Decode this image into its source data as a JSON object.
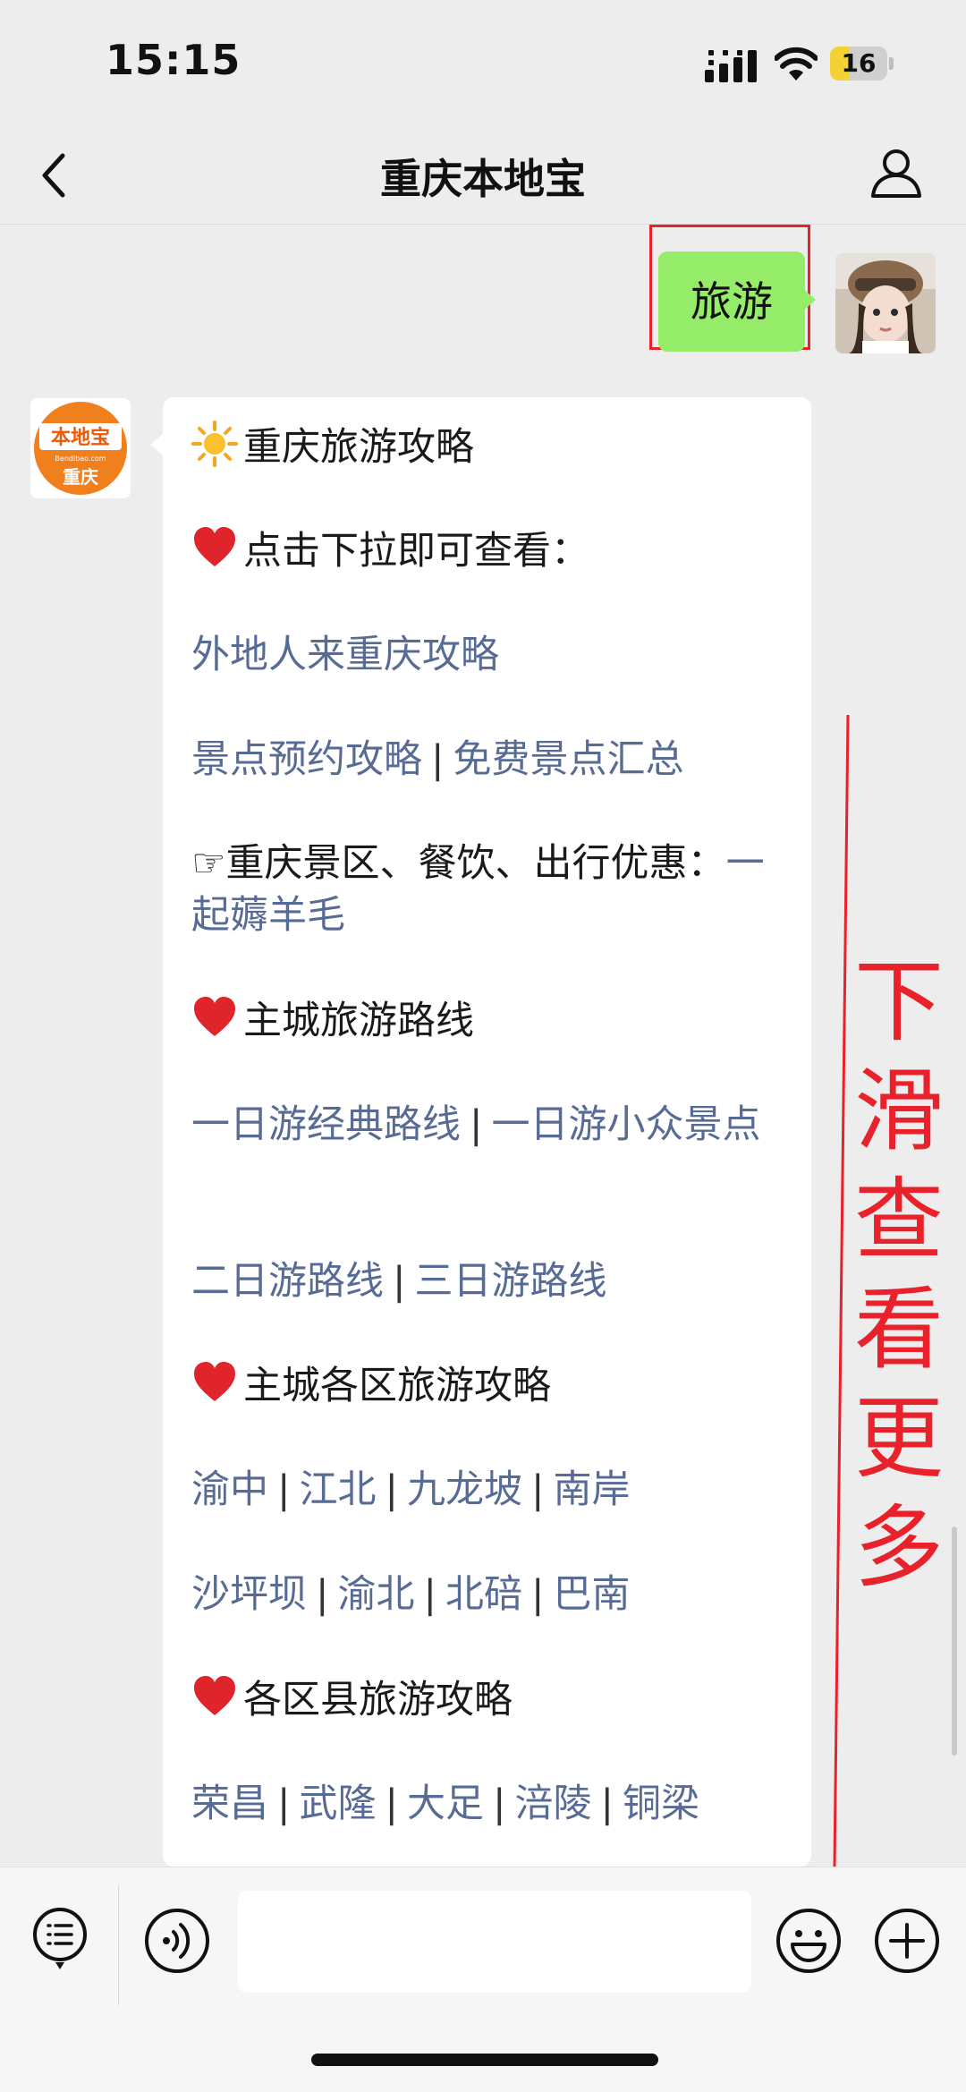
{
  "status_bar": {
    "time": "15:15",
    "battery": "16",
    "battery_level": 0.16
  },
  "nav": {
    "title": "重庆本地宝",
    "back_icon": "chevron-left-icon",
    "profile_icon": "person-icon"
  },
  "user_message": {
    "text": "旅游"
  },
  "bot": {
    "avatar_logo": "本地宝 Bendibao.com 重庆",
    "lines": {
      "l1": "重庆旅游攻略",
      "l2": "点击下拉即可查看：",
      "l3": "外地人来重庆攻略",
      "l4a": "景点预约攻略",
      "l4b": "免费景点汇总",
      "l5a": "☞重庆景区、餐饮、出行优惠：",
      "l5b": "一起薅羊毛",
      "l6": "主城旅游路线",
      "l7a": "一日游经典路线",
      "l7b": "一日游小众景点",
      "l8a": "二日游路线",
      "l8b": "三日游路线",
      "l9": "主城各区旅游攻略",
      "l10": [
        "渝中",
        "江北",
        "九龙坡",
        "南岸"
      ],
      "l11": [
        "沙坪坝",
        "渝北",
        "北碚",
        "巴南"
      ],
      "l12": "各区县旅游攻略",
      "l13": [
        "荣昌",
        "武隆",
        "大足",
        "涪陵",
        "铜梁"
      ]
    },
    "separator": "|"
  },
  "annotation": {
    "text": "下滑查看更多",
    "color": "#e8212b"
  },
  "colors": {
    "link": "#576b95",
    "bubble_green": "#95ec69",
    "annotation_red": "#e8212b"
  },
  "bottom_bar": {
    "icons": [
      "list-menu-icon",
      "voice-icon",
      "emoji-icon",
      "plus-icon"
    ],
    "input_value": ""
  }
}
